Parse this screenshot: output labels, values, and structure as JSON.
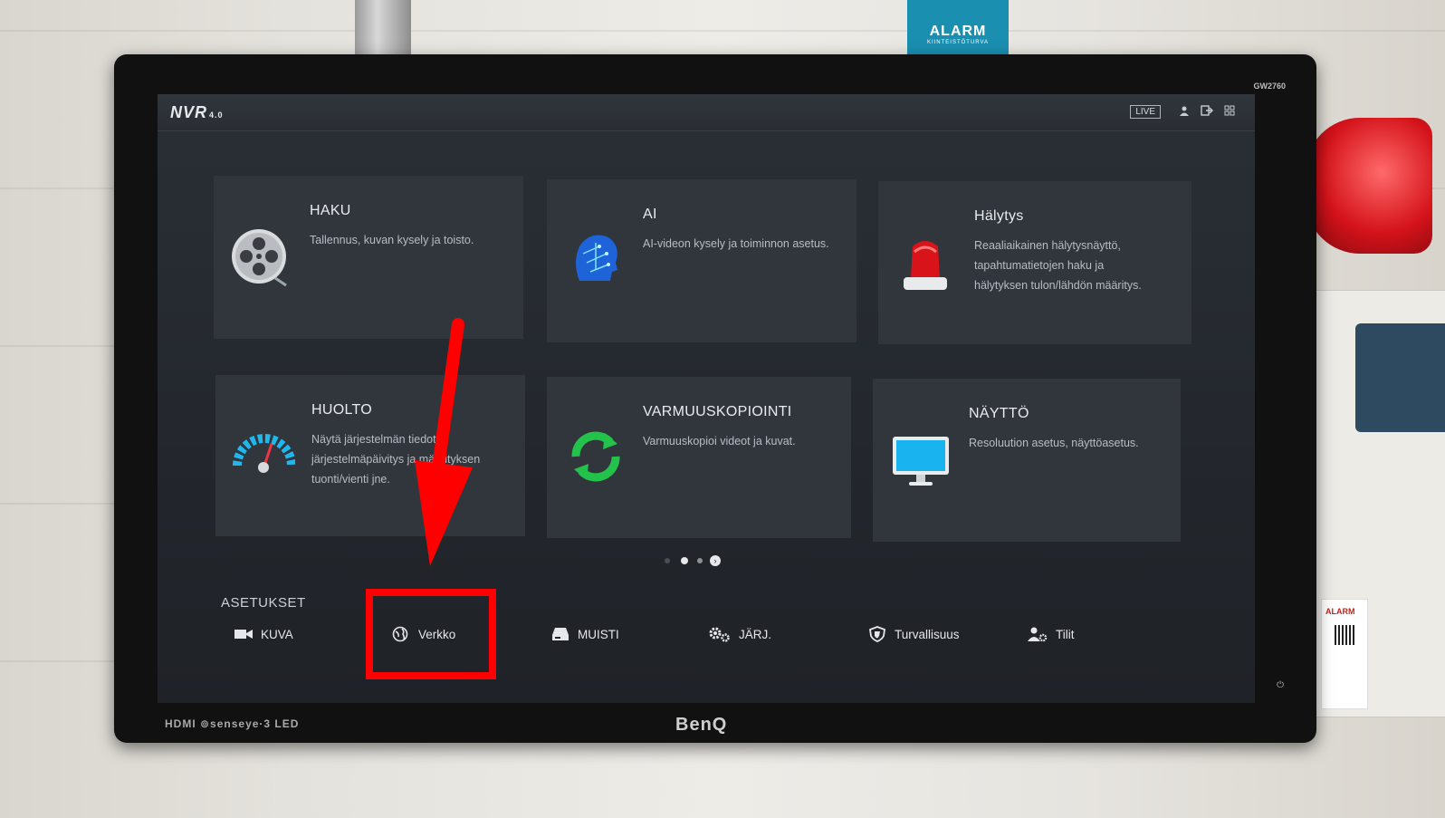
{
  "topbar": {
    "logo": "NVR",
    "logo_version": "4.0",
    "live_label": "LIVE",
    "icons": [
      "user-icon",
      "logout-icon",
      "grid-icon"
    ]
  },
  "tiles": [
    {
      "title": "HAKU",
      "desc": "Tallennus, kuvan kysely ja toisto.",
      "icon": "film-reel-icon"
    },
    {
      "title": "AI",
      "desc": "AI-videon kysely ja toiminnon asetus.",
      "icon": "ai-head-icon"
    },
    {
      "title": "Hälytys",
      "desc": "Reaaliaikainen hälytysnäyttö,\ntapahtumatietojen haku ja\nhälytyksen tulon/lähdön määritys.",
      "icon": "siren-icon"
    },
    {
      "title": "HUOLTO",
      "desc": "Näytä järjestelmän tiedot,\njärjestelmäpäivitys ja määrityksen\ntuonti/vienti jne.",
      "icon": "gauge-icon"
    },
    {
      "title": "VARMUUSKOPIOINTI",
      "desc": "Varmuuskopioi videot ja kuvat.",
      "icon": "backup-icon"
    },
    {
      "title": "NÄYTTÖ",
      "desc": "Resoluution asetus, näyttöasetus.",
      "icon": "monitor-icon"
    }
  ],
  "pagination": {
    "pages": 3,
    "current": 1
  },
  "settings": {
    "title": "ASETUKSET",
    "items": [
      {
        "label": "KUVA",
        "icon": "camera-icon"
      },
      {
        "label": "Verkko",
        "icon": "globe-icon"
      },
      {
        "label": "MUISTI",
        "icon": "storage-icon"
      },
      {
        "label": "JÄRJ.",
        "icon": "gears-icon"
      },
      {
        "label": "Turvallisuus",
        "icon": "shield-icon"
      },
      {
        "label": "Tilit",
        "icon": "account-settings-icon"
      }
    ]
  },
  "monitor": {
    "brand": "BenQ",
    "model": "GW2760",
    "hdmi_label": "HDMI ⊚senseye·3 LED"
  },
  "environment": {
    "sign_text": "ALARM",
    "sign_subtext": "KIINTEISTÖTURVA",
    "card_text": "ALARM"
  },
  "colors": {
    "annotation": "#ff0000",
    "screen_bg": "#23272d",
    "tile_bg": "#31353c"
  }
}
